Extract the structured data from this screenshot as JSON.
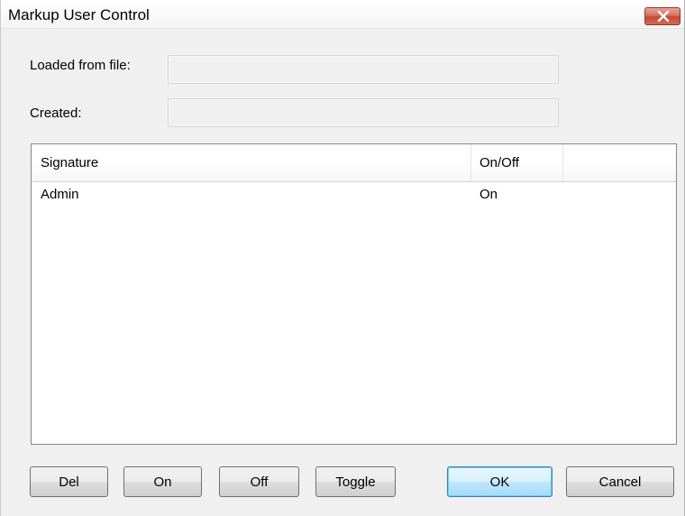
{
  "window": {
    "title": "Markup User Control"
  },
  "form": {
    "loaded_from_file_label": "Loaded from file:",
    "loaded_from_file_value": "",
    "created_label": "Created:",
    "created_value": ""
  },
  "list": {
    "columns": [
      "Signature",
      "On/Off"
    ],
    "rows": [
      {
        "signature": "Admin",
        "state": "On"
      }
    ]
  },
  "buttons": {
    "del": "Del",
    "on": "On",
    "off": "Off",
    "toggle": "Toggle",
    "ok": "OK",
    "cancel": "Cancel"
  },
  "icons": {
    "close": "close-icon"
  },
  "colors": {
    "close_button": "#c94a35",
    "default_button_border": "#3c7fb1",
    "dialog_background": "#f0f0f0"
  }
}
